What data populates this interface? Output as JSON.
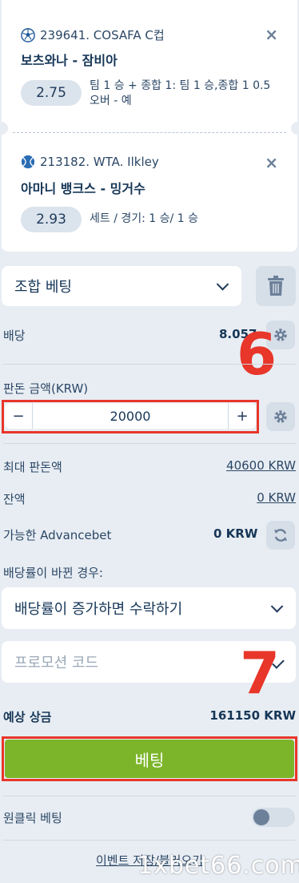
{
  "coupon": [
    {
      "event": "239641. COSAFA C컵",
      "match": "보츠와나 - 잠비아",
      "odds": "2.75",
      "outcome": "팀 1 승 + 종합 1: 팀 1 승,종합 1 0.5 오버 - 예",
      "sport_icon": "soccer-ball-icon"
    },
    {
      "event": "213182. WTA. Ilkley",
      "match": "아마니 뱅크스 - 밍거수",
      "odds": "2.93",
      "outcome": "세트 / 경기: 1 승/ 1 승",
      "sport_icon": "tennis-ball-icon"
    }
  ],
  "remove_label": "×",
  "bet_type": {
    "selected": "조합 베팅"
  },
  "odds_row": {
    "label": "배당",
    "value": "8.057"
  },
  "stake": {
    "label": "판돈 금액(KRW)",
    "minus": "−",
    "plus": "+",
    "value": "20000"
  },
  "max_stake": {
    "label": "최대 판돈액",
    "value": "40600 KRW"
  },
  "balance": {
    "label": "잔액",
    "value": "0 KRW"
  },
  "advancebet": {
    "label": "가능한 Advancebet",
    "value": "0 KRW"
  },
  "odds_change": {
    "label": "배당률이 바뀐 경우:",
    "selected": "배당률이 증가하면 수락하기"
  },
  "promo": {
    "placeholder": "프로모션 코드"
  },
  "potential_win": {
    "label": "예상 상금",
    "value": "161150 KRW"
  },
  "bet_button": "베팅",
  "one_click": {
    "label": "원클릭 베팅",
    "enabled": false
  },
  "footer": {
    "save_load": "이벤트 저장/불러오기"
  },
  "annotations": {
    "six": "6",
    "seven": "7"
  },
  "watermark": "1xbet66.com",
  "colors": {
    "accent_green": "#7cb52a",
    "annotation_red": "#e8362a",
    "background": "#e8edf3",
    "text_dark": "#163657"
  }
}
